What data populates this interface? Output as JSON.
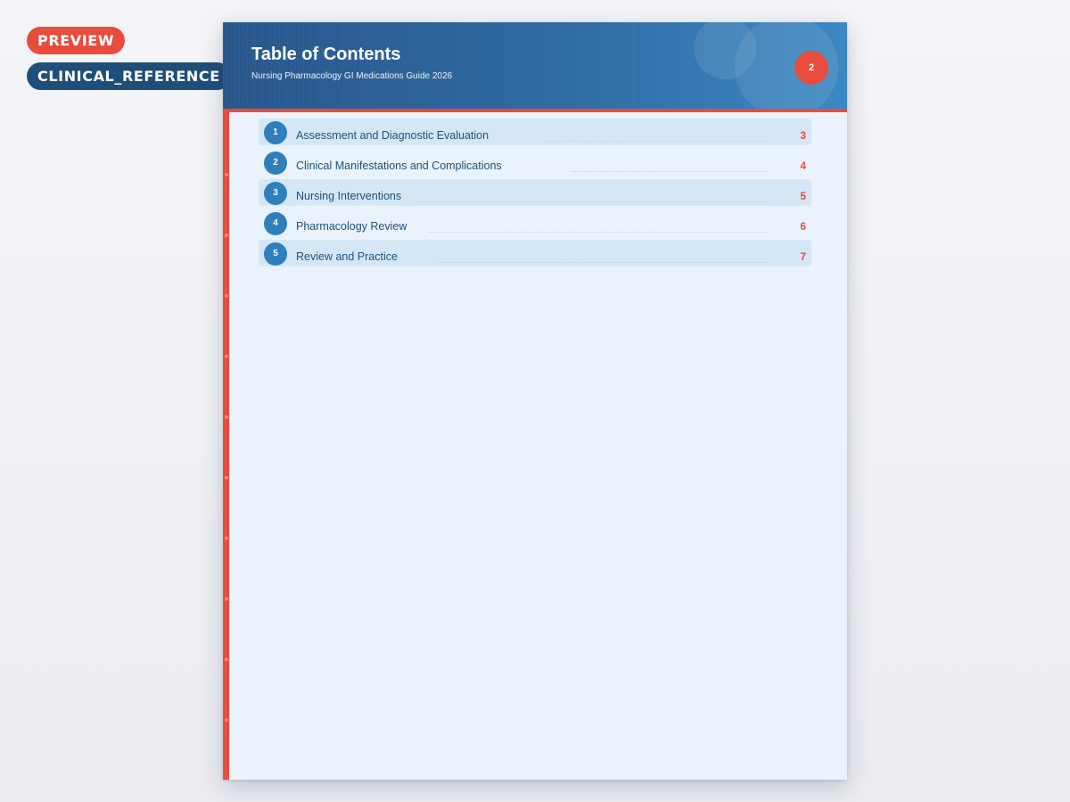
{
  "badges": {
    "preview": "PREVIEW",
    "type": "CLINICAL_REFERENCE"
  },
  "header": {
    "title": "Table of Contents",
    "subtitle": "Nursing Pharmacology GI Medications Guide 2026",
    "page_number": "2"
  },
  "toc": [
    {
      "number": "1",
      "title": "Assessment and Diagnostic Evaluation",
      "page": "3"
    },
    {
      "number": "2",
      "title": "Clinical Manifestations and Complications",
      "page": "4"
    },
    {
      "number": "3",
      "title": "Nursing Interventions",
      "page": "5"
    },
    {
      "number": "4",
      "title": "Pharmacology Review",
      "page": "6"
    },
    {
      "number": "5",
      "title": "Review and Practice",
      "page": "7"
    }
  ],
  "colors": {
    "accent_red": "#e74c3c",
    "header_blue": "#2d6aa3",
    "number_blue": "#2e7fbc",
    "text_navy": "#1f4e79"
  }
}
